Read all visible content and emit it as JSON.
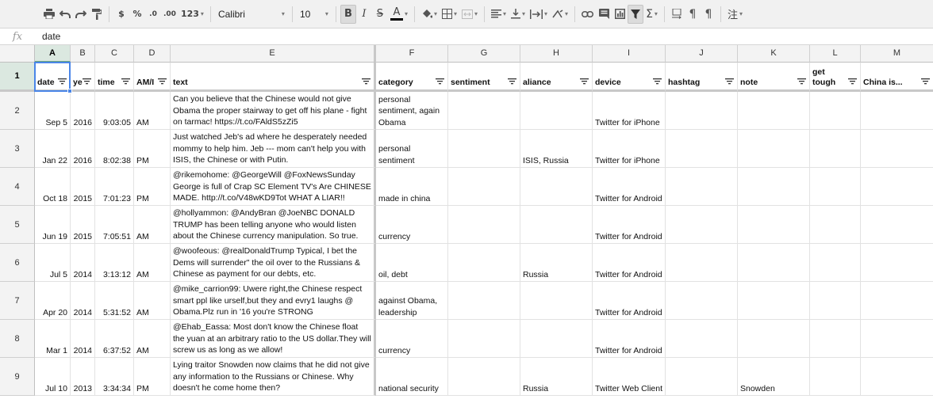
{
  "toolbar": {
    "currency": "$",
    "percent": "%",
    "decimal_decrease": ".0",
    "decimal_increase": ".00",
    "number_format": "123",
    "font": "Calibri",
    "font_size": "10",
    "bold": "B",
    "italic": "I",
    "strike": "S",
    "text_color": "A",
    "functions": "Σ",
    "ruby": "注",
    "icons": [
      "print-icon",
      "undo-icon",
      "redo-icon",
      "paint-format-icon",
      "fill-color-icon",
      "borders-icon",
      "merge-cells-icon",
      "align-left-icon",
      "valign-bottom-icon",
      "text-wrap-icon",
      "text-rotation-icon",
      "link-icon",
      "comment-icon",
      "chart-icon",
      "filter-icon",
      "functions-icon",
      "ltr-icon",
      "rtl-icon",
      "pilcrow-icon",
      "ruby-icon"
    ]
  },
  "formula_bar": {
    "label": "fx",
    "value": "date"
  },
  "columns": [
    {
      "letter": "A",
      "header": "date"
    },
    {
      "letter": "B",
      "header": "ye"
    },
    {
      "letter": "C",
      "header": "time"
    },
    {
      "letter": "D",
      "header": "AM/I"
    },
    {
      "letter": "E",
      "header": "text"
    },
    {
      "letter": "F",
      "header": "category"
    },
    {
      "letter": "G",
      "header": "sentiment"
    },
    {
      "letter": "H",
      "header": "aliance"
    },
    {
      "letter": "I",
      "header": "device"
    },
    {
      "letter": "J",
      "header": "hashtag"
    },
    {
      "letter": "K",
      "header": "note"
    },
    {
      "letter": "L",
      "header": "get\ntough"
    },
    {
      "letter": "M",
      "header": "China is..."
    }
  ],
  "header_row_number": "1",
  "rows": [
    {
      "num": "2",
      "date": "Sep 5",
      "year": "2016",
      "time": "9:03:05",
      "ampm": "AM",
      "text": "Can you believe that the Chinese would not give Obama the proper stairway to get off his plane - fight on tarmac! https://t.co/FAldS5zZi5",
      "category": "personal sentiment, again Obama",
      "sentiment": "",
      "aliance": "",
      "device": "Twitter for iPhone",
      "hashtag": "",
      "note": "",
      "tough": "",
      "china": ""
    },
    {
      "num": "3",
      "date": "Jan 22",
      "year": "2016",
      "time": "8:02:38",
      "ampm": "PM",
      "text": "Just watched Jeb's ad where he desperately needed mommy to help him. Jeb --- mom can't help you with ISIS, the Chinese or with Putin.",
      "category": "personal sentiment",
      "sentiment": "",
      "aliance": "ISIS, Russia",
      "device": "Twitter for iPhone",
      "hashtag": "",
      "note": "",
      "tough": "",
      "china": ""
    },
    {
      "num": "4",
      "date": "Oct 18",
      "year": "2015",
      "time": "7:01:23",
      "ampm": "PM",
      "text": "@rikemohome: @GeorgeWill @FoxNewsSunday George is full of Crap SC Element TV's Are CHINESE MADE. http://t.co/V48wKD9Tot WHAT A LIAR!!",
      "category": "made in china",
      "sentiment": "",
      "aliance": "",
      "device": "Twitter for Android",
      "hashtag": "",
      "note": "",
      "tough": "",
      "china": ""
    },
    {
      "num": "5",
      "date": "Jun 19",
      "year": "2015",
      "time": "7:05:51",
      "ampm": "AM",
      "text": "@hollyammon: @AndyBran @JoeNBC DONALD TRUMP has been telling anyone who would listen about the Chinese currency manipulation. So true.",
      "category": "currency",
      "sentiment": "",
      "aliance": "",
      "device": "Twitter for Android",
      "hashtag": "",
      "note": "",
      "tough": "",
      "china": ""
    },
    {
      "num": "6",
      "date": "Jul 5",
      "year": "2014",
      "time": "3:13:12",
      "ampm": "AM",
      "text": "@woofeous: @realDonaldTrump Typical, I bet the Dems will surrender\" the oil over to the Russians & Chinese as payment for our debts, etc.",
      "category": "oil, debt",
      "sentiment": "",
      "aliance": "Russia",
      "device": "Twitter for Android",
      "hashtag": "",
      "note": "",
      "tough": "",
      "china": ""
    },
    {
      "num": "7",
      "date": "Apr 20",
      "year": "2014",
      "time": "5:31:52",
      "ampm": "AM",
      "text": "@mike_carrion99: Uwere right,the Chinese respect smart ppl like urself,but they and evry1 laughs @ Obama.Plz run in '16 you're STRONG",
      "category": "against Obama, leadership",
      "sentiment": "",
      "aliance": "",
      "device": "Twitter for Android",
      "hashtag": "",
      "note": "",
      "tough": "",
      "china": ""
    },
    {
      "num": "8",
      "date": "Mar 1",
      "year": "2014",
      "time": "6:37:52",
      "ampm": "AM",
      "text": "@Ehab_Eassa: Most don't know the Chinese float the yuan at an arbitrary ratio to the US dollar.They will screw us as long as we allow!",
      "category": "currency",
      "sentiment": "",
      "aliance": "",
      "device": "Twitter for Android",
      "hashtag": "",
      "note": "",
      "tough": "",
      "china": ""
    },
    {
      "num": "9",
      "date": "Jul 10",
      "year": "2013",
      "time": "3:34:34",
      "ampm": "PM",
      "text": "Lying traitor Snowden now claims that he did not give any information to the Russians or Chinese. Why doesn't he come home then?",
      "category": "national security",
      "sentiment": "",
      "aliance": "Russia",
      "device": "Twitter Web Client",
      "hashtag": "",
      "note": "Snowden",
      "tough": "",
      "china": ""
    }
  ]
}
